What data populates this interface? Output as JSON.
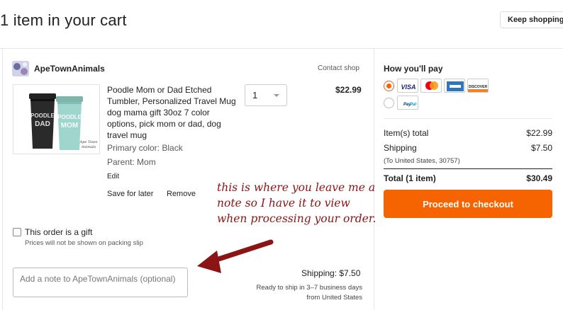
{
  "page": {
    "title": "1 item in your cart",
    "keep_shopping": "Keep shopping"
  },
  "shop": {
    "name": "ApeTownAnimals",
    "contact": "Contact shop",
    "logo_text": "Ape Town Animals"
  },
  "item": {
    "title": "Poodle Mom or Dad Etched Tumbler, Personalized Travel Mug dog mama gift 30oz 7 color options, pick mom or dad, dog travel mug",
    "image_text_dad": "POODLE DAD",
    "image_text_mom": "POODLE MOM",
    "image_brand": "Ape Town Animals",
    "variations": [
      "Primary color: Black",
      "Parent: Mom"
    ],
    "edit": "Edit",
    "save_for_later": "Save for later",
    "remove": "Remove",
    "quantity": "1",
    "price": "$22.99"
  },
  "annotation": {
    "text": "this is where you leave me a note so I have it to view when processing your order.",
    "color": "#8b1414"
  },
  "gift": {
    "label": "This order is a gift",
    "note": "Prices will not be shown on packing slip",
    "checked": false
  },
  "note": {
    "placeholder": "Add a note to ApeTownAnimals (optional)",
    "value": ""
  },
  "shipping": {
    "cost": "Shipping: $7.50",
    "time": "Ready to ship in 3–7 business days",
    "from": "from United States"
  },
  "payment": {
    "title": "How you'll pay",
    "options": [
      {
        "id": "cards",
        "selected": true,
        "cards": [
          "visa-icon",
          "mastercard-icon",
          "amex-icon",
          "discover-icon"
        ]
      },
      {
        "id": "paypal",
        "selected": false,
        "cards": [
          "paypal-icon"
        ]
      }
    ]
  },
  "summary": {
    "items_label": "Item(s) total",
    "items_value": "$22.99",
    "shipping_label": "Shipping",
    "shipping_value": "$7.50",
    "shipping_dest": "(To United States, 30757)",
    "total_label": "Total (1 item)",
    "total_value": "$30.49"
  },
  "checkout": {
    "label": "Proceed to checkout"
  },
  "colors": {
    "accent": "#f56400",
    "annotation": "#8b1414"
  }
}
